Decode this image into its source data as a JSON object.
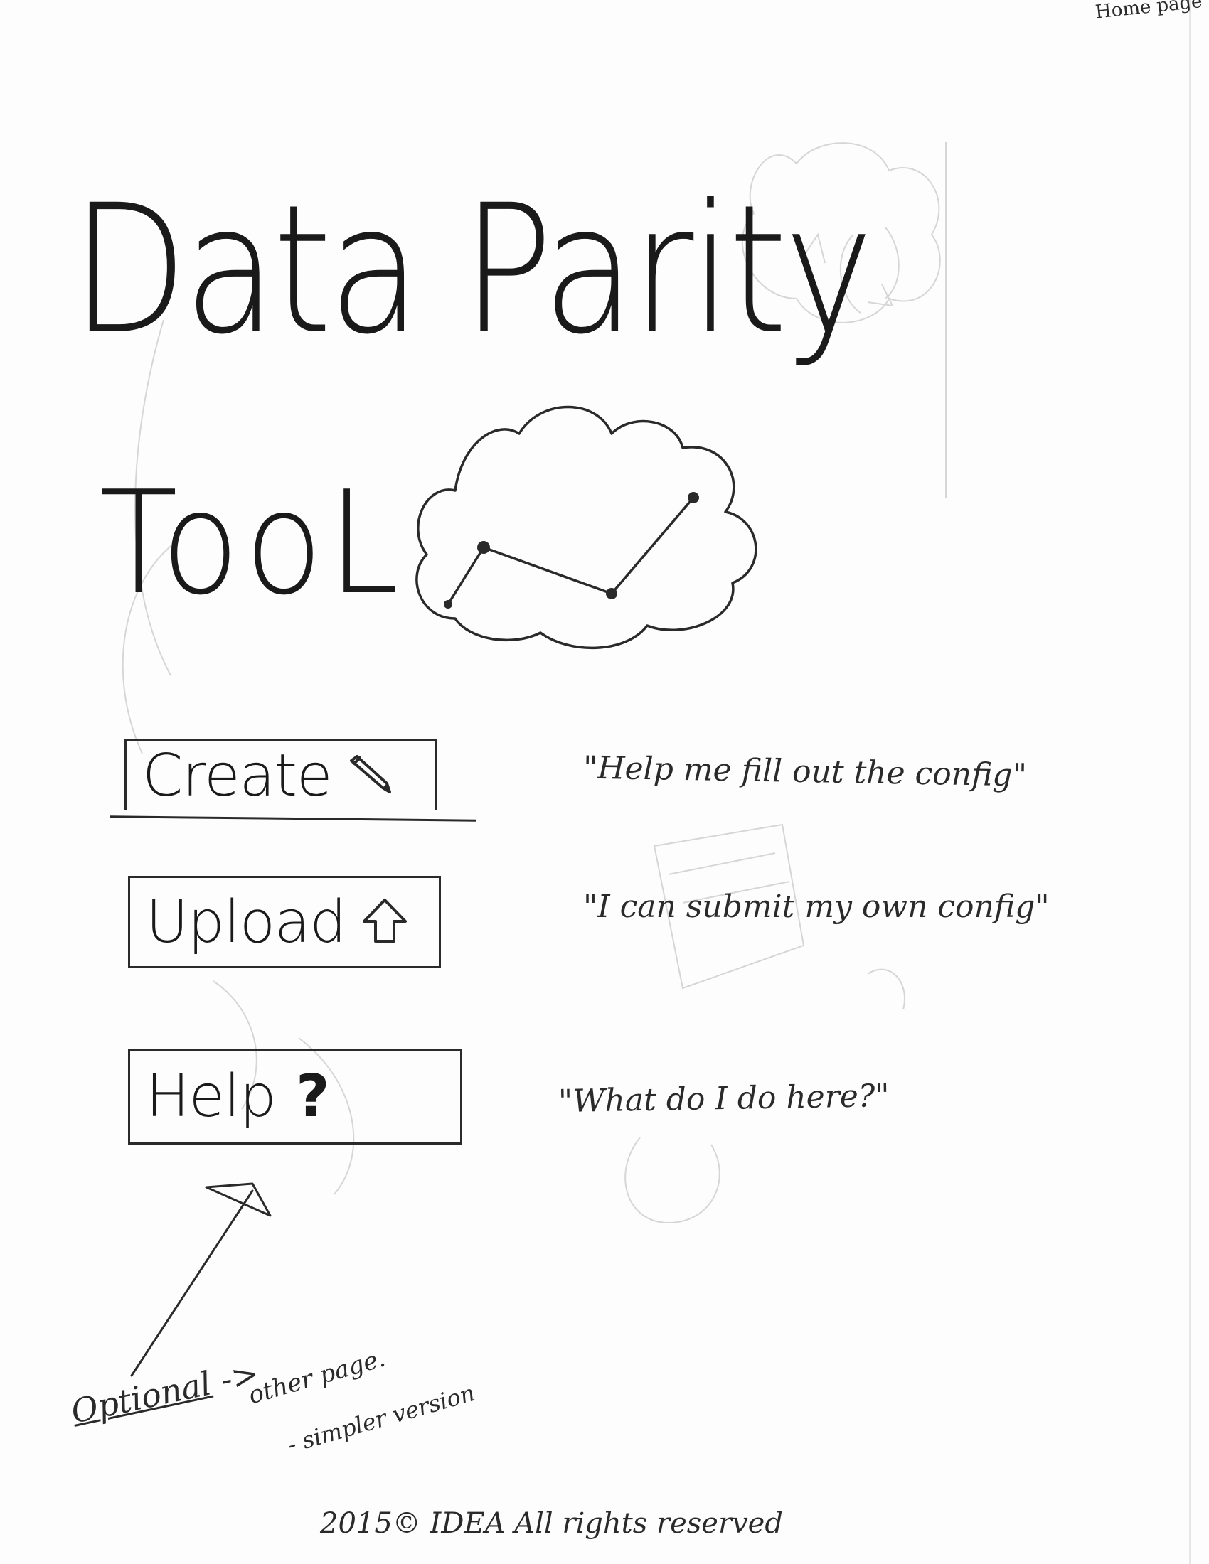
{
  "corner_note": "Home page",
  "title": "Data Parity",
  "subtitle": "TooL",
  "buttons": {
    "create": {
      "label": "Create",
      "icon": "pencil-icon"
    },
    "upload": {
      "label": "Upload",
      "icon": "up-arrow-icon"
    },
    "help": {
      "label": "Help",
      "icon": "question-mark-icon",
      "icon_glyph": "?"
    }
  },
  "quotes": {
    "create": "\"Help me fill out the config\"",
    "upload": "\"I can submit my own config\"",
    "help": "\"What do I do here?\""
  },
  "notes": {
    "optional": "Optional",
    "arrow_text": "->",
    "other_page": "other page.",
    "simpler": "- simpler version"
  },
  "footer": "2015© IDEA All rights reserved",
  "logo_icon": "cloud-graph-icon",
  "colors": {
    "ink": "#2a2a2a",
    "paper": "#fdfdfd",
    "faint_pencil": "#cfcfcf"
  }
}
